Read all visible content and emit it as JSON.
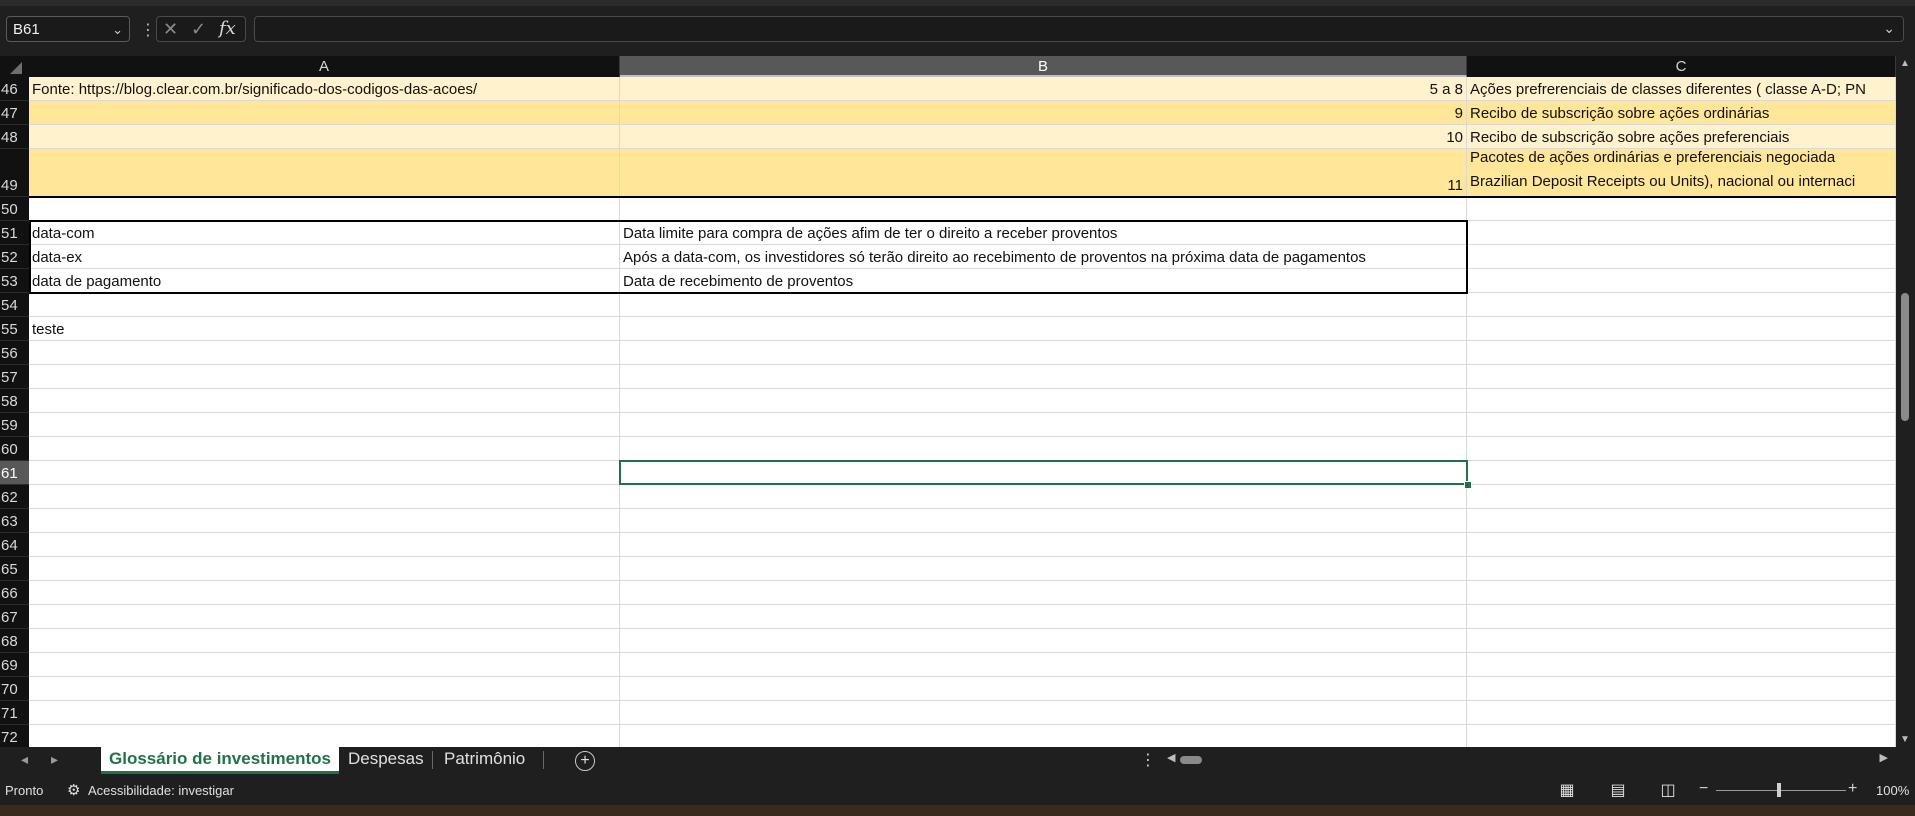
{
  "formula_bar": {
    "name_box": "B61",
    "formula_value": ""
  },
  "columns": [
    "A",
    "B",
    "C"
  ],
  "rows": [
    {
      "num": "46",
      "a": "Fonte: https://blog.clear.com.br/significado-dos-codigos-das-acoes/",
      "b": "5 a 8",
      "c": "Ações prefrerenciais de classes diferentes ( classe A-D; PN"
    },
    {
      "num": "47",
      "a": "",
      "b": "9",
      "c": "Recibo de subscrição sobre ações  ordinárias"
    },
    {
      "num": "48",
      "a": "",
      "b": "10",
      "c": "Recibo de subscrição sobre ações  preferenciais"
    },
    {
      "num": "49",
      "a": "",
      "b": "11",
      "c": "Pacotes de ações ordinárias e preferenciais negociada",
      "c2": "Brazilian Deposit Receipts ou Units), nacional ou internaci"
    },
    {
      "num": "50",
      "a": "",
      "b": "",
      "c": ""
    },
    {
      "num": "51",
      "a": "data-com",
      "b": "Data limite para compra de ações afim de ter o direito a receber proventos",
      "c": ""
    },
    {
      "num": "52",
      "a": "data-ex",
      "b": "Após a data-com, os investidores só terão direito ao recebimento de proventos na próxima data de pagamentos",
      "c": ""
    },
    {
      "num": "53",
      "a": "data de pagamento",
      "b": "Data de recebimento de proventos",
      "c": ""
    },
    {
      "num": "54",
      "a": "",
      "b": "",
      "c": ""
    },
    {
      "num": "55",
      "a": "teste",
      "b": "",
      "c": ""
    },
    {
      "num": "56"
    },
    {
      "num": "57"
    },
    {
      "num": "58"
    },
    {
      "num": "59"
    },
    {
      "num": "60"
    },
    {
      "num": "61"
    },
    {
      "num": "62"
    },
    {
      "num": "63"
    },
    {
      "num": "64"
    },
    {
      "num": "65"
    },
    {
      "num": "66"
    },
    {
      "num": "67"
    },
    {
      "num": "68"
    },
    {
      "num": "69"
    },
    {
      "num": "70"
    },
    {
      "num": "71"
    },
    {
      "num": "72"
    }
  ],
  "selected_cell": "B61",
  "sheets": {
    "tabs": [
      "Glossário de investimentos",
      "Despesas",
      "Patrimônio"
    ],
    "active": "Glossário de investimentos"
  },
  "status": {
    "ready": "Pronto",
    "accessibility": "Acessibilidade: investigar",
    "zoom": "100%"
  },
  "colors": {
    "selection": "#217346",
    "band_light": "#fff2cc",
    "band_dark": "#ffe699"
  },
  "icons": [
    "chevron-down-icon",
    "cancel-icon",
    "check-icon",
    "fx-icon",
    "add-sheet-icon",
    "accessibility-icon",
    "normal-view-icon",
    "page-layout-icon",
    "page-break-icon"
  ]
}
